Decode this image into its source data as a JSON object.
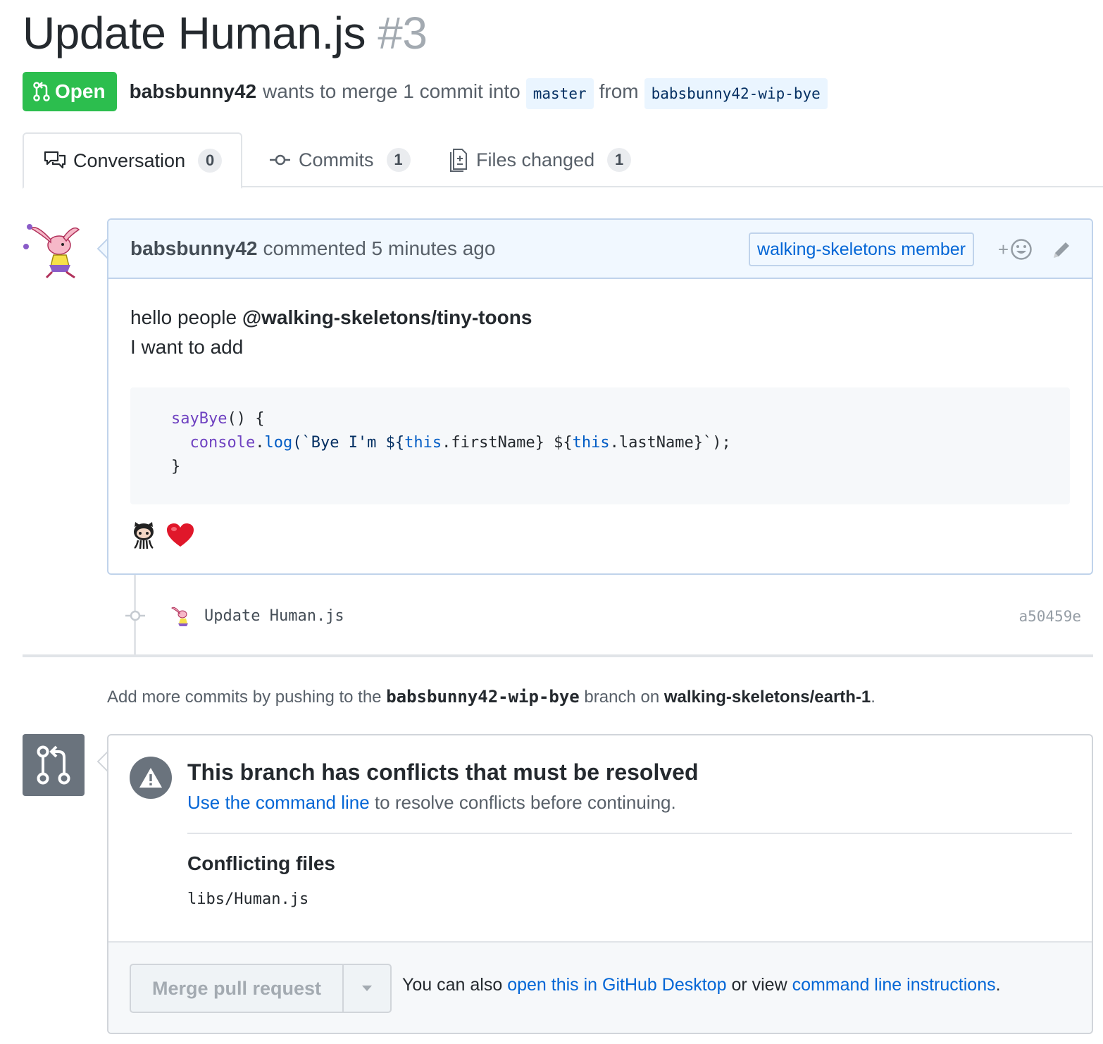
{
  "pr": {
    "title": "Update Human.js",
    "number": "#3",
    "state": "Open",
    "author": "babsbunny42",
    "merge_text": "wants to merge 1 commit into",
    "base_branch": "master",
    "from_text": "from",
    "head_branch": "babsbunny42-wip-bye"
  },
  "tabs": [
    {
      "label": "Conversation",
      "count": "0"
    },
    {
      "label": "Commits",
      "count": "1"
    },
    {
      "label": "Files changed",
      "count": "1"
    }
  ],
  "comment": {
    "author": "babsbunny42",
    "action": "commented 5 minutes ago",
    "badge": "walking-skeletons member",
    "react_plus": "+",
    "body_line1": "hello people",
    "mention": "@walking-skeletons/tiny-toons",
    "body_line2": "I want to add",
    "code": {
      "line1_fn": "sayBye",
      "line1_rest": "() {",
      "line2_obj": "console",
      "line2_dot": ".",
      "line2_method": "log",
      "line2_str_a": "(`Bye I'm ${",
      "line2_this1": "this",
      "line2_str_b": ".firstName} ${",
      "line2_this2": "this",
      "line2_str_c": ".lastName}`);",
      "line3": "}"
    },
    "reactions": [
      "octocat-icon",
      "heart-icon"
    ]
  },
  "commit": {
    "message": "Update Human.js",
    "sha": "a50459e"
  },
  "push_note": {
    "prefix": "Add more commits by pushing to the",
    "branch": "babsbunny42-wip-bye",
    "middle": "branch on",
    "repo": "walking-skeletons/earth-1",
    "suffix": "."
  },
  "merge": {
    "title": "This branch has conflicts that must be resolved",
    "sub_link": "Use the command line",
    "sub_rest": "to resolve conflicts before continuing.",
    "conflicts_heading": "Conflicting files",
    "conflict_file": "libs/Human.js",
    "button_label": "Merge pull request",
    "footer_prefix": "You can also",
    "footer_link1": "open this in GitHub Desktop",
    "footer_middle": "or view",
    "footer_link2": "command line instructions",
    "footer_suffix": "."
  },
  "colors": {
    "open_green": "#2cbe4e",
    "link_blue": "#0366d6",
    "comment_border": "#c0d3eb",
    "comment_header_bg": "#f1f8ff",
    "ref_bg": "#eaf5ff"
  }
}
